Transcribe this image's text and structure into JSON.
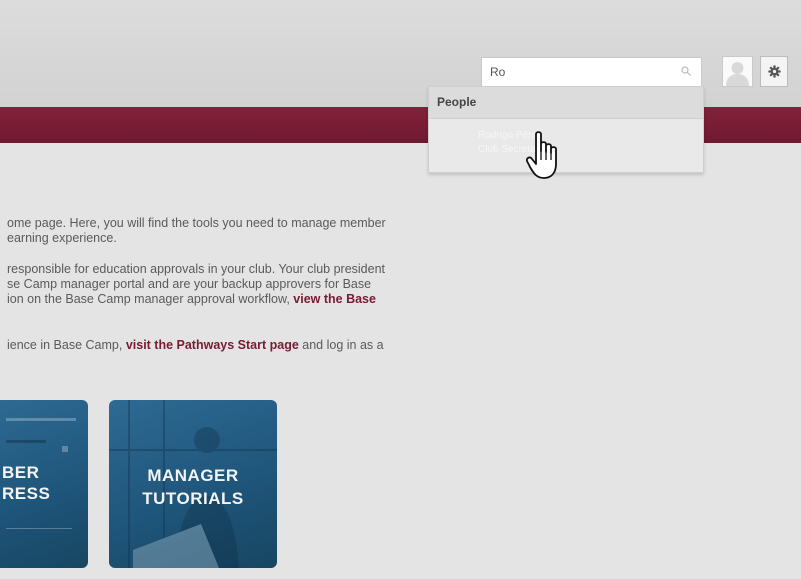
{
  "header": {
    "search": {
      "value": "Ro",
      "placeholder": ""
    }
  },
  "dropdown": {
    "header": "People",
    "result": {
      "name": "Rodrigo Pérez",
      "role": "Club Secretary"
    }
  },
  "content": {
    "p1": [
      "ome page. Here, you will find the tools you need to manage member",
      "earning experience."
    ],
    "p2": [
      "responsible for education approvals in your club. Your club president",
      "se Camp manager portal and are your backup approvers for Base"
    ],
    "p2_line3_text": "ion on the Base Camp manager approval workflow, ",
    "p2_line3_link": "view the Base",
    "p3_text_before": "ience in Base Camp, ",
    "p3_link": "visit the Pathways Start page",
    "p3_text_after": " and log in as a"
  },
  "tiles": [
    {
      "line1": "BER",
      "line2": "RESS"
    },
    {
      "line1": "MANAGER",
      "line2": "TUTORIALS"
    }
  ],
  "colors": {
    "brand": "#7a1a33",
    "tile": "#245f86",
    "background": "#e4e4e4"
  }
}
